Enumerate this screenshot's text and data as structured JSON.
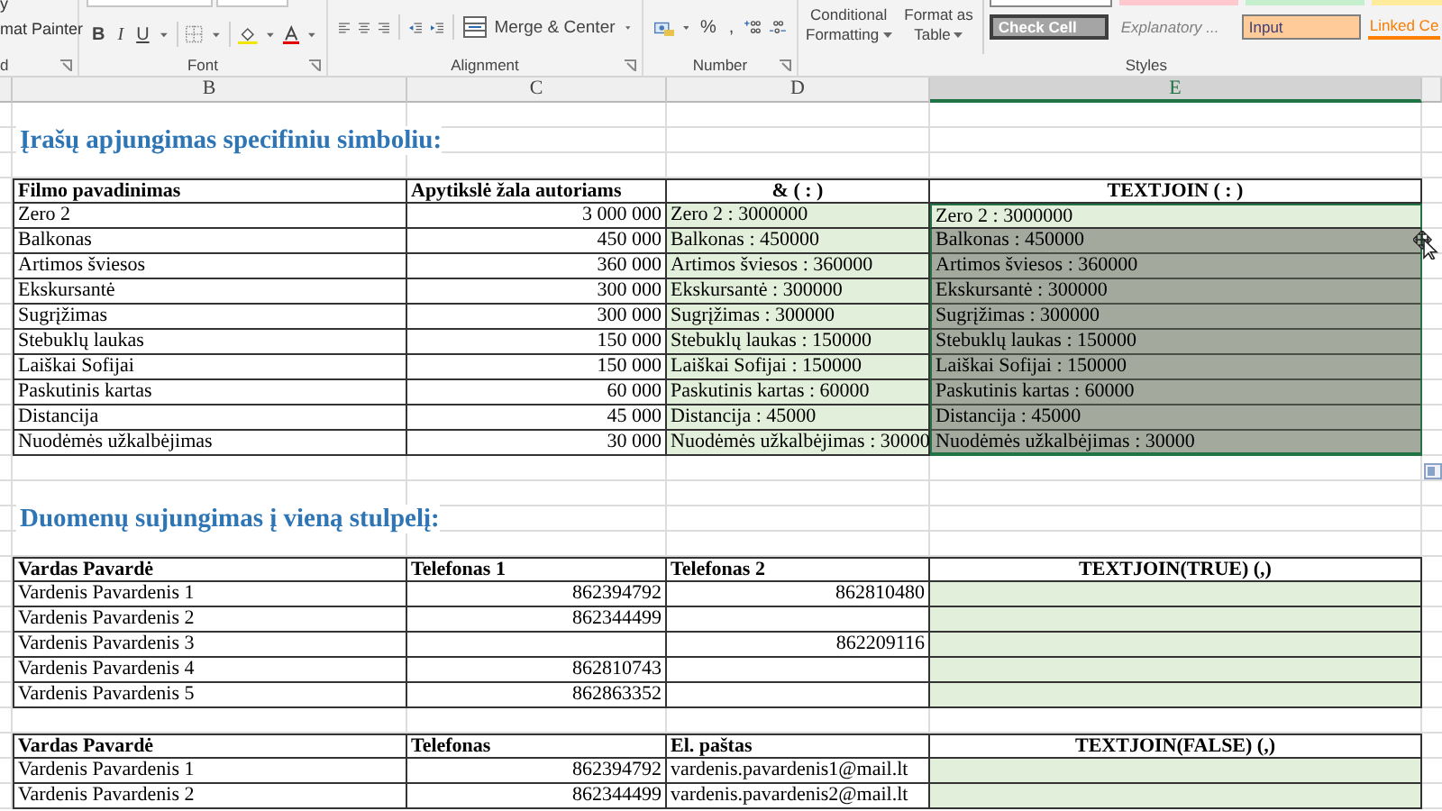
{
  "ribbon": {
    "clipboard": {
      "items": [
        "y",
        "mat Painter"
      ],
      "label": "d"
    },
    "font": {
      "buttons": [
        "B",
        "I",
        "U"
      ],
      "label": "Font"
    },
    "alignment": {
      "merge": "Merge & Center",
      "label": "Alignment"
    },
    "number": {
      "buttons": [
        "%",
        ","
      ],
      "label": "Number"
    },
    "styles": {
      "buttons": [
        {
          "line1": "Conditional",
          "line2": "Formatting"
        },
        {
          "line1": "Format as",
          "line2": "Table"
        }
      ],
      "cell_styles": [
        {
          "label": "Check Cell",
          "kind": "check"
        },
        {
          "label": "Explanatory ...",
          "kind": "explanatory"
        },
        {
          "label": "Input",
          "kind": "input"
        },
        {
          "label": "Linked Ce",
          "kind": "linked"
        }
      ],
      "label": "Styles"
    }
  },
  "sheet": {
    "columns": [
      {
        "label": "B",
        "selected": false
      },
      {
        "label": "C",
        "selected": false
      },
      {
        "label": "D",
        "selected": false
      },
      {
        "label": "E",
        "selected": true
      }
    ],
    "sections": [
      {
        "title": "Įrašų apjungimas specifiniu simboliu:",
        "columns": [
          "Filmo pavadinimas",
          "Apytikslė žala autoriams",
          "& ( : )",
          "TEXTJOIN ( : )"
        ],
        "rows": [
          {
            "name": "Zero 2",
            "amount": "3 000 000",
            "joined": "Zero 2 : 3000000",
            "textjoin": "Zero 2 : 3000000",
            "selected": false
          },
          {
            "name": "Balkonas",
            "amount": "450 000",
            "joined": "Balkonas : 450000",
            "textjoin": "Balkonas : 450000",
            "selected": true
          },
          {
            "name": "Artimos šviesos",
            "amount": "360 000",
            "joined": "Artimos šviesos : 360000",
            "textjoin": "Artimos šviesos : 360000",
            "selected": true
          },
          {
            "name": "Ekskursantė",
            "amount": "300 000",
            "joined": "Ekskursantė : 300000",
            "textjoin": "Ekskursantė : 300000",
            "selected": true
          },
          {
            "name": "Sugrįžimas",
            "amount": "300 000",
            "joined": "Sugrįžimas : 300000",
            "textjoin": "Sugrįžimas : 300000",
            "selected": true
          },
          {
            "name": "Stebuklų laukas",
            "amount": "150 000",
            "joined": "Stebuklų laukas : 150000",
            "textjoin": "Stebuklų laukas : 150000",
            "selected": true
          },
          {
            "name": "Laiškai Sofijai",
            "amount": "150 000",
            "joined": "Laiškai Sofijai : 150000",
            "textjoin": "Laiškai Sofijai : 150000",
            "selected": true
          },
          {
            "name": "Paskutinis kartas",
            "amount": "60 000",
            "joined": "Paskutinis kartas : 60000",
            "textjoin": "Paskutinis kartas : 60000",
            "selected": true
          },
          {
            "name": "Distancija",
            "amount": "45 000",
            "joined": "Distancija : 45000",
            "textjoin": "Distancija : 45000",
            "selected": true
          },
          {
            "name": "Nuodėmės užkalbėjimas",
            "amount": "30 000",
            "joined": "Nuodėmės užkalbėjimas : 30000",
            "textjoin": "Nuodėmės užkalbėjimas : 30000",
            "selected": true
          }
        ]
      },
      {
        "title": "Duomenų sujungimas į vieną stulpelį:",
        "columns": [
          "Vardas Pavardė",
          "Telefonas 1",
          "Telefonas 2",
          "TEXTJOIN(TRUE) (,)"
        ],
        "rows": [
          {
            "name": "Vardenis Pavardenis 1",
            "phone": "862394792",
            "extra": "862810480"
          },
          {
            "name": "Vardenis Pavardenis 2",
            "phone": "862344499"
          },
          {
            "name": "Vardenis Pavardenis 3",
            "extra": "862209116"
          },
          {
            "name": "Vardenis Pavardenis 4",
            "phone": "862810743"
          },
          {
            "name": "Vardenis Pavardenis 5",
            "phone": "862863352"
          }
        ]
      },
      {
        "columns": [
          "Vardas Pavardė",
          "Telefonas",
          "El. paštas",
          "TEXTJOIN(FALSE) (,)"
        ],
        "rows": [
          {
            "name": "Vardenis Pavardenis 1",
            "phone": "862394792",
            "email": "vardenis.pavardenis1@mail.lt"
          },
          {
            "name": "Vardenis Pavardenis 2",
            "phone": "862344499",
            "email": "vardenis.pavardenis2@mail.lt"
          }
        ]
      }
    ]
  }
}
